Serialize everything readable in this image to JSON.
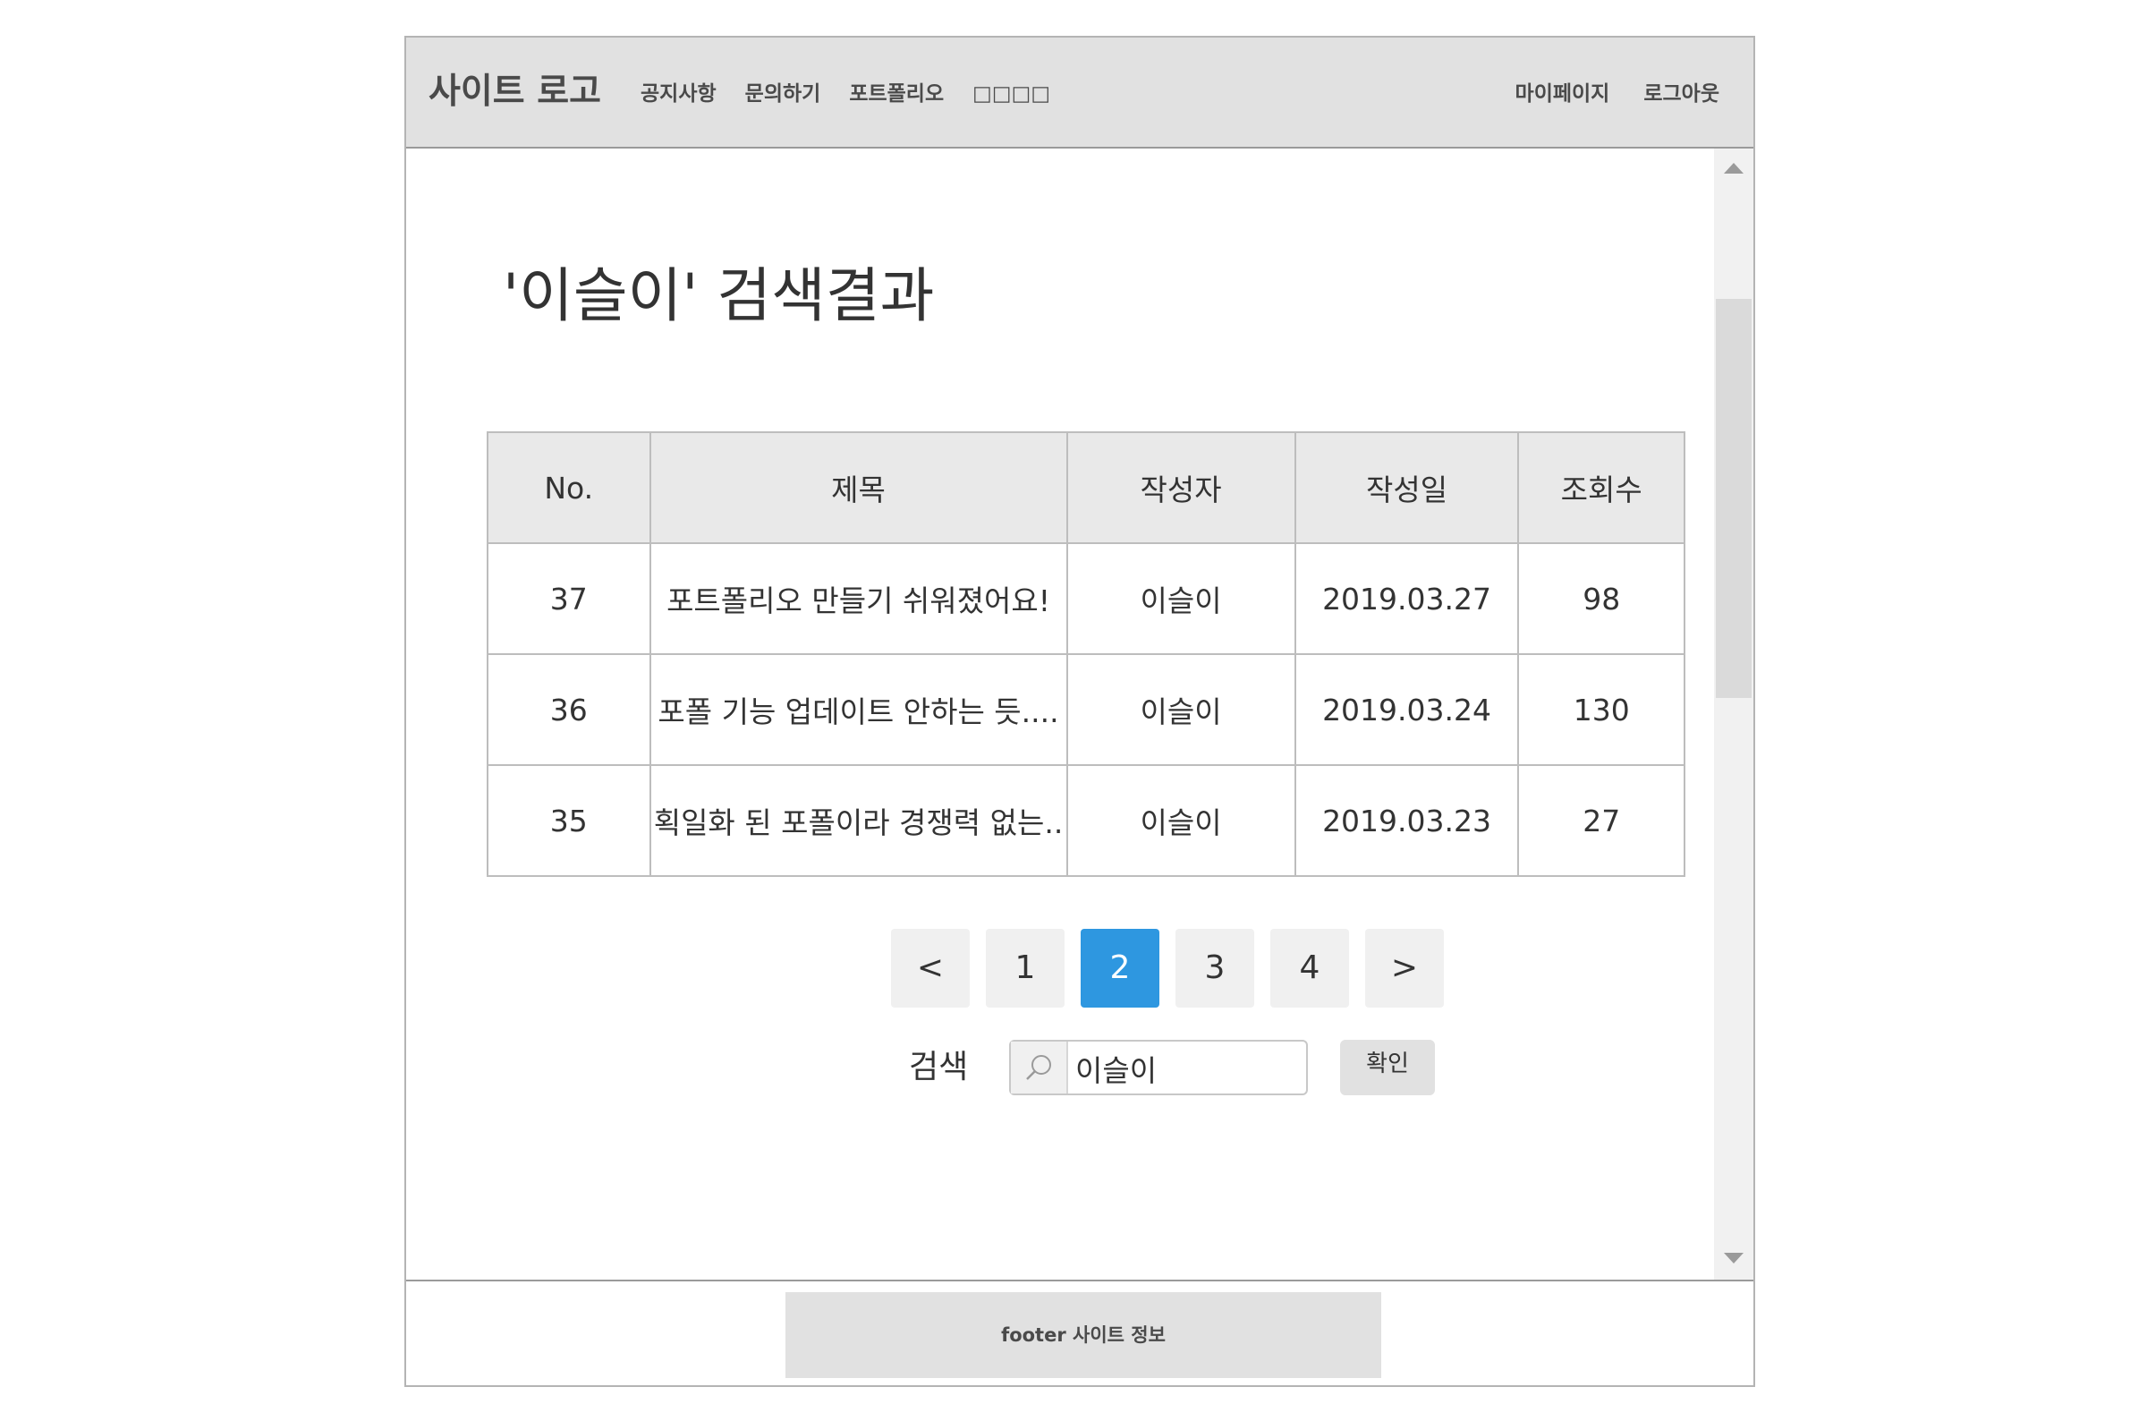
{
  "header": {
    "logo": "사이트 로고",
    "nav": [
      "공지사항",
      "문의하기",
      "포트폴리오",
      "□□□□"
    ],
    "right_nav": [
      "마이페이지",
      "로그아웃"
    ]
  },
  "main": {
    "title": "'이슬이' 검색결과",
    "table": {
      "columns": [
        "No.",
        "제목",
        "작성자",
        "작성일",
        "조회수"
      ],
      "rows": [
        {
          "no": "37",
          "title": "포트폴리오 만들기 쉬워졌어요!",
          "author": "이슬이",
          "date": "2019.03.27",
          "views": "98"
        },
        {
          "no": "36",
          "title": "포폴 기능 업데이트 안하는 듯....",
          "author": "이슬이",
          "date": "2019.03.24",
          "views": "130"
        },
        {
          "no": "35",
          "title": "획일화 된 포폴이라 경쟁력 없는..",
          "author": "이슬이",
          "date": "2019.03.23",
          "views": "27"
        }
      ]
    },
    "pagination": {
      "prev": "<",
      "pages": [
        "1",
        "2",
        "3",
        "4"
      ],
      "next": ">",
      "current": "2"
    },
    "search": {
      "label": "검색",
      "value": "이슬이",
      "icon": "search-icon",
      "button": "확인"
    }
  },
  "footer": {
    "text": "footer 사이트 정보"
  },
  "colors": {
    "header_bg": "#e1e1e1",
    "accent": "#2e97e0",
    "table_header_bg": "#e9e9e9"
  }
}
